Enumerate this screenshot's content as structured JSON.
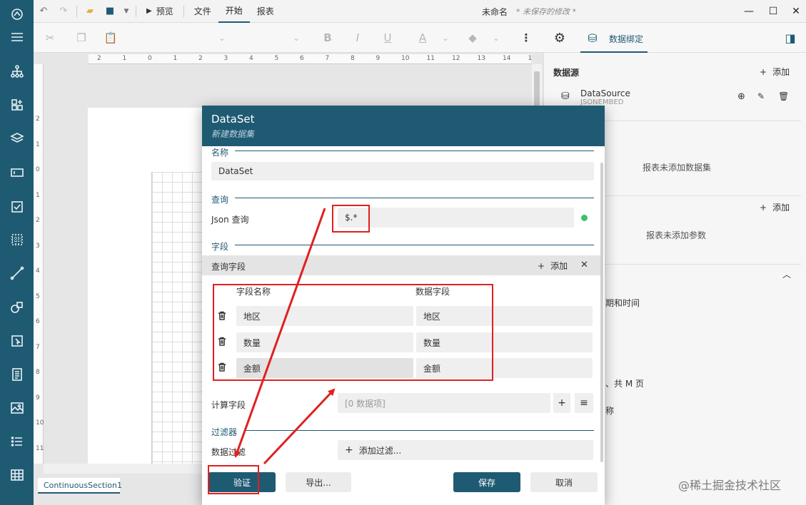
{
  "titlebar": {
    "preview": "预览",
    "menu_file": "文件",
    "menu_start": "开始",
    "menu_report": "报表",
    "doc_name": "未命名",
    "unsaved": "* 未保存的修改 *"
  },
  "right_panel": {
    "binding_tab": "数据绑定",
    "datasource_title": "数据源",
    "add_label": "添加",
    "ds_name": "DataSource",
    "ds_type": "JSONEMBED",
    "no_dataset": "报表未添加数据集",
    "no_param": "报表未添加参数",
    "partial_datetime": "期和时间",
    "partial_pages": "、共 M 页",
    "partial_name": "称"
  },
  "canvas": {
    "section_tab": "ContinuousSection1",
    "ruler_h": [
      "2",
      "1",
      "0",
      "1",
      "2",
      "3",
      "4",
      "5",
      "6",
      "7",
      "8",
      "9",
      "10",
      "11",
      "12",
      "13",
      "14",
      "1"
    ],
    "ruler_v": [
      "2",
      "1",
      "0",
      "1",
      "2",
      "3",
      "4",
      "5",
      "6",
      "7",
      "8",
      "9",
      "10",
      "11"
    ]
  },
  "dialog": {
    "title": "DataSet",
    "subtitle": "新建数据集",
    "name_section": "名称",
    "name_value": "DataSet",
    "query_section": "查询",
    "json_query_label": "Json 查询",
    "json_query_value": "$.*",
    "fields_section": "字段",
    "query_fields_label": "查询字段",
    "add_label": "添加",
    "col_field_name": "字段名称",
    "col_data_field": "数据字段",
    "fields": [
      {
        "name": "地区",
        "data_field": "地区"
      },
      {
        "name": "数量",
        "data_field": "数量"
      },
      {
        "name": "金额",
        "data_field": "金额"
      }
    ],
    "calc_fields_label": "计算字段",
    "calc_fields_placeholder": "[0 数据项]",
    "filter_section": "过滤器",
    "data_filter_label": "数据过滤",
    "add_filter": "添加过滤...",
    "btn_validate": "验证",
    "btn_export": "导出...",
    "btn_save": "保存",
    "btn_cancel": "取消"
  },
  "watermark": "@稀土掘金技术社区",
  "colors": {
    "brand": "#1f5a73",
    "annotation_red": "#e02020",
    "status_green": "#3cc06b"
  }
}
